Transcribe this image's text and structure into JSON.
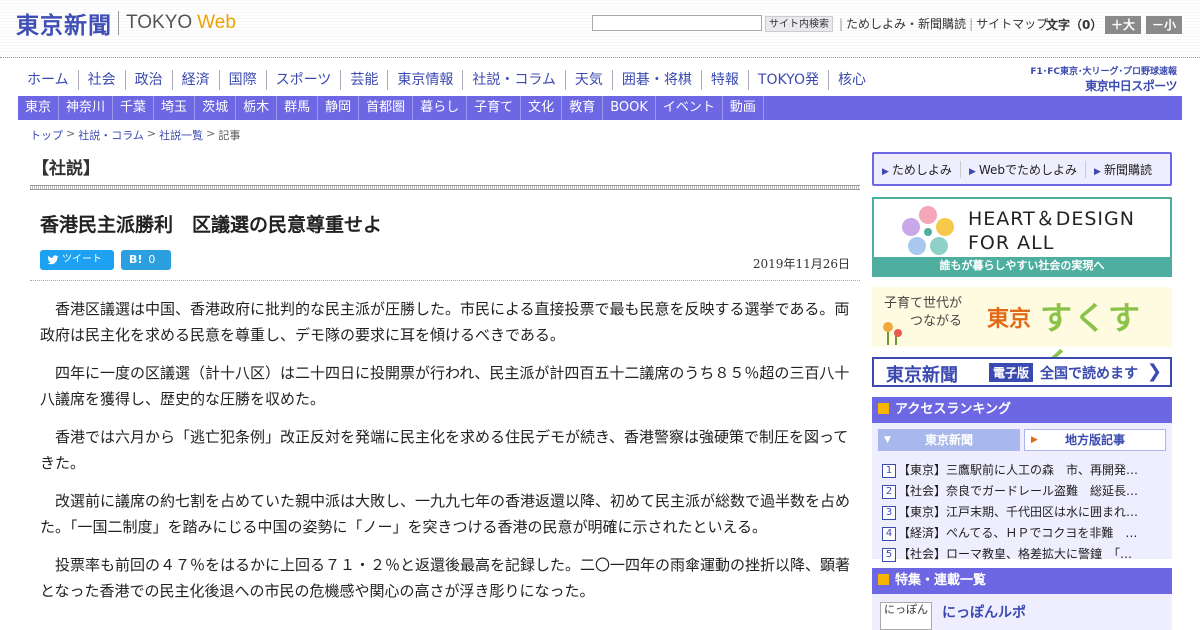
{
  "header": {
    "logo_kanji": "東京新聞",
    "logo_en": "TOKYO",
    "logo_web": "Web",
    "search_button": "サイト内検索",
    "links": [
      "ためしよみ・新聞購読",
      "サイトマップ"
    ],
    "font_label": "文字（0）",
    "font_larger": "＋大",
    "font_smaller": "－小"
  },
  "main_nav": [
    "ホーム",
    "社会",
    "政治",
    "経済",
    "国際",
    "スポーツ",
    "芸能",
    "東京情報",
    "社説・コラム",
    "天気",
    "囲碁・将棋",
    "特報",
    "TOKYO発",
    "核心"
  ],
  "chunichi": {
    "top": "F1･FC東京･大リーグ･プロ野球速報",
    "bottom": "東京中日スポーツ"
  },
  "sub_nav": [
    "東京",
    "神奈川",
    "千葉",
    "埼玉",
    "茨城",
    "栃木",
    "群馬",
    "静岡",
    "首都圏",
    "暮らし",
    "子育て",
    "文化",
    "教育",
    "BOOK",
    "イベント",
    "動画"
  ],
  "breadcrumb": [
    "トップ",
    "社説・コラム",
    "社説一覧",
    "記事"
  ],
  "article": {
    "section": "【社説】",
    "title": "香港民主派勝利　区議選の民意尊重せよ",
    "tweet_label": "ツイート",
    "hatena_label": "B!",
    "hatena_count": "0",
    "date": "2019年11月26日",
    "paragraphs": [
      "香港区議選は中国、香港政府に批判的な民主派が圧勝した。市民による直接投票で最も民意を反映する選挙である。両政府は民主化を求める民意を尊重し、デモ隊の要求に耳を傾けるべきである。",
      "四年に一度の区議選（計十八区）は二十四日に投開票が行われ、民主派が計四百五十二議席のうち８５％超の三百八十八議席を獲得し、歴史的な圧勝を収めた。",
      "香港では六月から「逃亡犯条例」改正反対を発端に民主化を求める住民デモが続き、香港警察は強硬策で制圧を図ってきた。",
      "改選前に議席の約七割を占めていた親中派は大敗し、一九九七年の香港返還以降、初めて民主派が総数で過半数を占めた。「一国二制度」を踏みにじる中国の姿勢に「ノー」を突きつける香港の民意が明確に示されたといえる。",
      "投票率も前回の４７％をはるかに上回る７１・２％と返還後最高を記録した。二〇一四年の雨傘運動の挫折以降、顕著となった香港での民主化後退への市民の危機感や関心の高さが浮き彫りになった。"
    ]
  },
  "sidebar": {
    "trial_links": [
      "ためしよみ",
      "Webでためしよみ",
      "新聞購読"
    ],
    "hd_title_1": "HEART＆DESIGN",
    "hd_title_2": "FOR ALL",
    "hd_caption": "誰もが暮らしやすい社会の実現へ",
    "sk_sub_1": "子育て世代が",
    "sk_sub_2": "つながる",
    "sk_main_a": "東京",
    "sk_main_b": "すくすく",
    "digital_logo": "東京新聞",
    "digital_edition": "電子版",
    "digital_read": "全国で読めます",
    "ranking_title": "アクセスランキング",
    "ranking_tab_a": "東京新聞",
    "ranking_tab_b": "地方版記事",
    "ranking": [
      {
        "num": "1",
        "text": "【東京】三鷹駅前に人工の森　市、再開発…"
      },
      {
        "num": "2",
        "text": "【社会】奈良でガードレール盗難　総延長…"
      },
      {
        "num": "3",
        "text": "【東京】江戸末期、千代田区は水に囲まれ…"
      },
      {
        "num": "4",
        "text": "【経済】ぺんてる、ＨＰでコクヨを非難　…"
      },
      {
        "num": "5",
        "text": "【社会】ローマ教皇、格差拡大に警鐘　「…"
      }
    ],
    "features_title": "特集・連載一覧",
    "feature_img_text": "にっぽん",
    "feature_title": "にっぽんルポ"
  },
  "colors": {
    "brand": "#3f4fb6",
    "nav_bar": "#6d67e3",
    "accent": "#f7b500",
    "twitter": "#1da1f2",
    "teal": "#4eaea0"
  }
}
